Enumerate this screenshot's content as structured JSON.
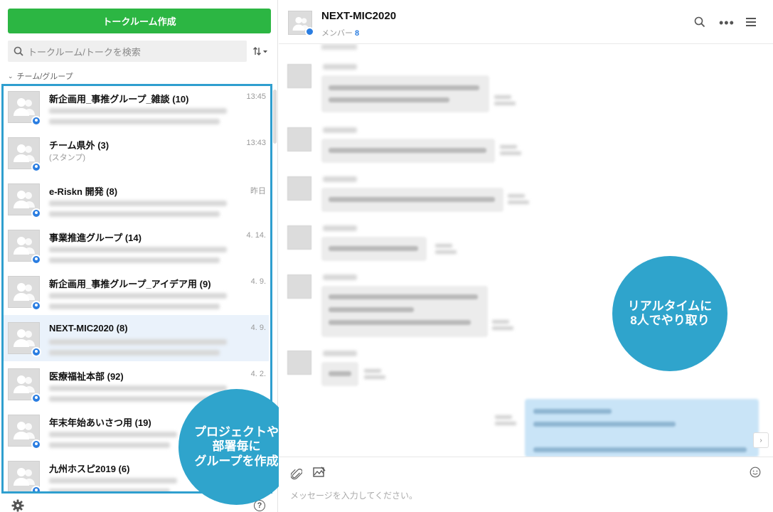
{
  "left": {
    "create_button": "トークルーム作成",
    "search_placeholder": "トークルーム/トークを検索",
    "sort_icon": "sort-icon",
    "section_label": "チーム/グループ",
    "chats": [
      {
        "name": "新企画用_事推グループ_雑談 (10)",
        "sub": "",
        "time": "13:45",
        "selected": false
      },
      {
        "name": "チーム県外 (3)",
        "sub": "(スタンプ)",
        "time": "13:43",
        "selected": false
      },
      {
        "name": "e-Riskn 開発 (8)",
        "sub": "",
        "time": "昨日",
        "selected": false
      },
      {
        "name": "事業推進グループ (14)",
        "sub": "",
        "time": "4. 14.",
        "selected": false
      },
      {
        "name": "新企画用_事推グループ_アイデア用 (9)",
        "sub": "",
        "time": "4. 9.",
        "selected": false
      },
      {
        "name": "NEXT-MIC2020 (8)",
        "sub": "",
        "time": "4. 9.",
        "selected": true
      },
      {
        "name": "医療福祉本部 (92)",
        "sub": "",
        "time": "4. 2.",
        "selected": false
      },
      {
        "name": "年末年始あいさつ用 (19)",
        "sub": "",
        "time": "",
        "selected": false
      },
      {
        "name": "九州ホスピ2019 (6)",
        "sub": "",
        "time": "",
        "selected": false
      }
    ],
    "callout": [
      "プロジェクトや",
      "部署毎に",
      "グループを作成"
    ]
  },
  "right": {
    "room_title": "NEXT-MIC2020",
    "members_label": "メンバー",
    "members_count": "8",
    "input_placeholder": "メッセージを入力してください。",
    "callout": [
      "リアルタイムに",
      "8人でやり取り"
    ]
  },
  "colors": {
    "accent_green": "#2cb643",
    "callout_blue": "#2fa4cc",
    "selected_row": "#eaf2fb",
    "badge_blue": "#2a7de1"
  }
}
